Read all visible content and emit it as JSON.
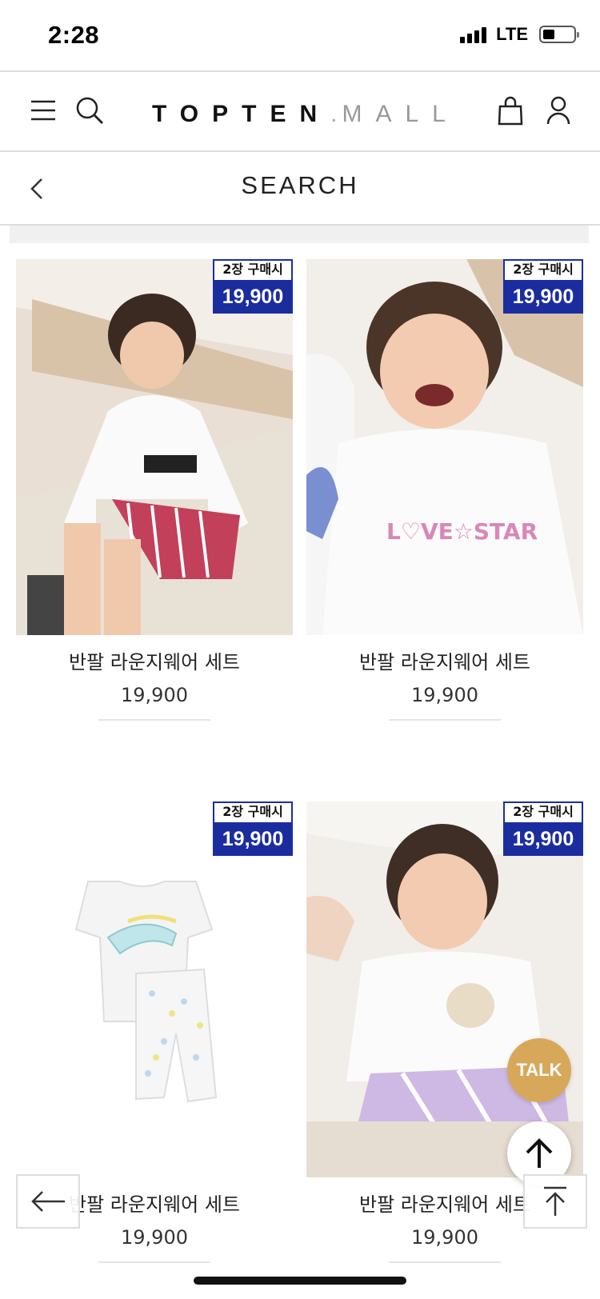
{
  "status_bar": {
    "time": "2:28",
    "network": "LTE"
  },
  "header": {
    "logo_brand": "TOPTEN",
    "logo_dot": ".",
    "logo_suffix": "MALL",
    "icons": [
      "menu-icon",
      "search-icon",
      "shopping-bag-icon",
      "user-icon"
    ]
  },
  "subheader": {
    "title": "SEARCH",
    "back_icon": "chevron-left-icon"
  },
  "products": [
    {
      "name": "반팔 라운지웨어 세트",
      "price": "19,900",
      "badge_top": "2장 구매시",
      "badge_price": "19,900"
    },
    {
      "name": "반팔 라운지웨어 세트",
      "price": "19,900",
      "badge_top": "2장 구매시",
      "badge_price": "19,900"
    },
    {
      "name": "반팔 라운지웨어 세트",
      "price": "19,900",
      "badge_top": "2장 구매시",
      "badge_price": "19,900"
    },
    {
      "name": "반팔 라운지웨어 세트",
      "price": "19,900",
      "badge_top": "2장 구매시",
      "badge_price": "19,900"
    }
  ],
  "floating": {
    "talk_label": "TALK"
  },
  "colors": {
    "badge_blue": "#1b2d9e",
    "talk_gold": "#d8a85a"
  }
}
